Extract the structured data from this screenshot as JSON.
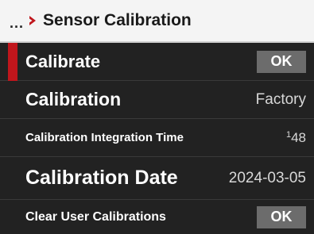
{
  "header": {
    "ellipsis": "...",
    "title": "Sensor Calibration"
  },
  "colors": {
    "accent": "#c0161c",
    "header_bg": "#f4f4f4",
    "panel_bg": "#222222",
    "button_bg": "#6c6c6c"
  },
  "icons": {
    "breadcrumb_chevron": "chevron-right-icon"
  },
  "menu": {
    "calibrate": {
      "label": "Calibrate",
      "button": "OK"
    },
    "calibration": {
      "label": "Calibration",
      "value": "Factory"
    },
    "integration_time": {
      "label": "Calibration Integration Time",
      "numerator": "1",
      "denominator": "48"
    },
    "calibration_date": {
      "label": "Calibration Date",
      "value": "2024-03-05"
    },
    "clear_user": {
      "label": "Clear User Calibrations",
      "button": "OK"
    }
  }
}
